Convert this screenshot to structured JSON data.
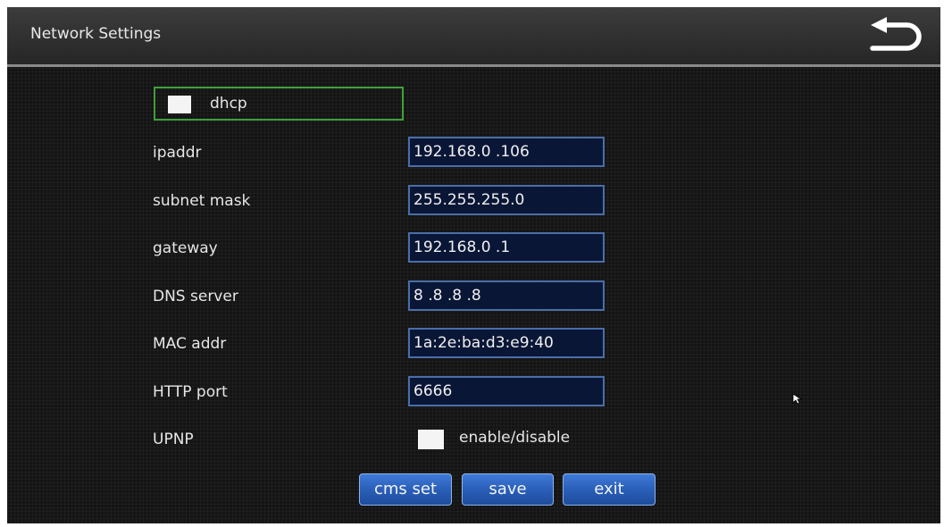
{
  "header": {
    "title": "Network Settings",
    "back_icon": "return-arrow-icon"
  },
  "dhcp": {
    "label": "dhcp",
    "checked": false
  },
  "fields": [
    {
      "label": "ipaddr",
      "value": "192.168.0  .106"
    },
    {
      "label": "subnet mask",
      "value": "255.255.255.0"
    },
    {
      "label": "gateway",
      "value": "192.168.0  .1"
    },
    {
      "label": "DNS server",
      "value": "8  .8  .8  .8"
    },
    {
      "label": "MAC addr",
      "value": "1a:2e:ba:d3:e9:40"
    },
    {
      "label": "HTTP port",
      "value": "6666"
    }
  ],
  "upnp": {
    "label": "UPNP",
    "option_label": "enable/disable",
    "checked": false
  },
  "buttons": {
    "cms_set": "cms set",
    "save": "save",
    "exit": "exit"
  },
  "colors": {
    "background": "#141414",
    "field_background": "#0a1636",
    "field_border": "#4a6ea8",
    "dhcp_border": "#3fa03a",
    "button_blue": "#2a5fb8"
  }
}
